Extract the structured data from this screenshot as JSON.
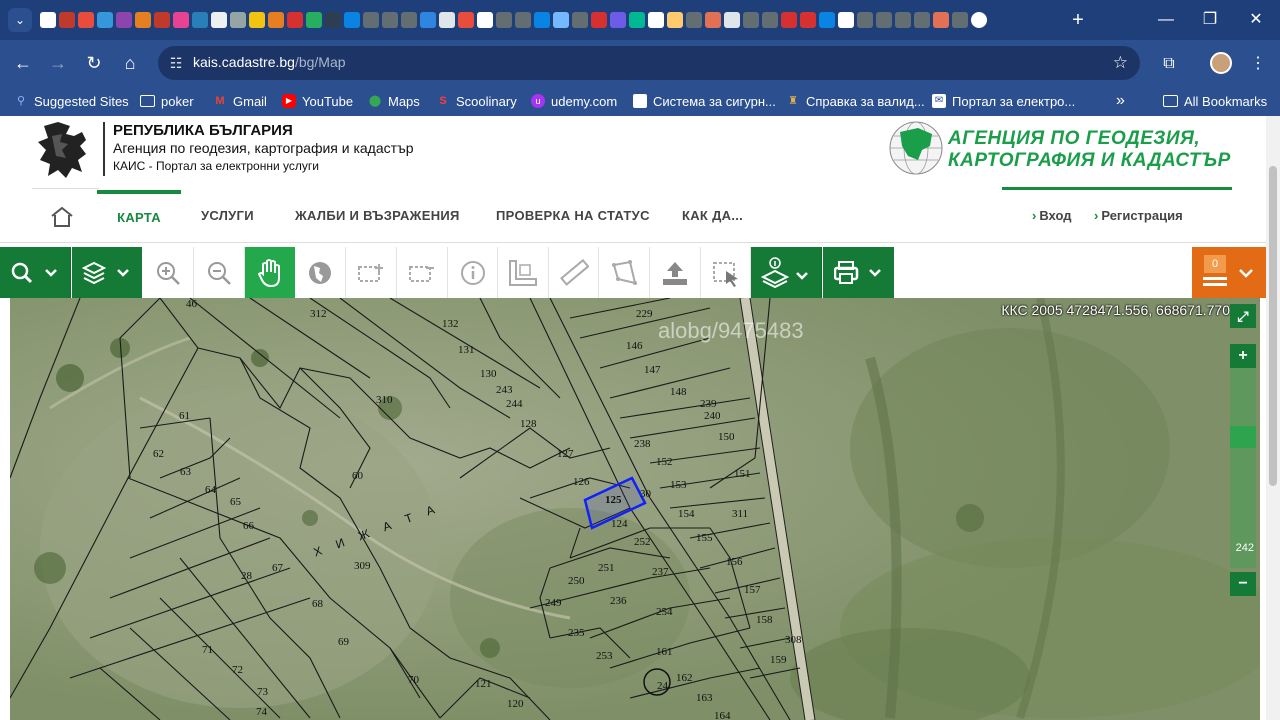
{
  "browser": {
    "address": {
      "host": "kais.cadastre.bg",
      "path": "/bg/Map"
    },
    "bookmarks": [
      {
        "label": "Suggested Sites",
        "icon": "magnifier-icon"
      },
      {
        "label": "poker",
        "icon": "folder-icon"
      },
      {
        "label": "Gmail",
        "icon": "gmail-icon"
      },
      {
        "label": "YouTube",
        "icon": "youtube-icon"
      },
      {
        "label": "Maps",
        "icon": "maps-pin-icon"
      },
      {
        "label": "Scoolinary",
        "icon": "scoolinary-icon"
      },
      {
        "label": "udemy.com",
        "icon": "udemy-icon"
      },
      {
        "label": "Система за сигурн...",
        "icon": "page-icon"
      },
      {
        "label": "Справка за валид...",
        "icon": "crest-icon"
      },
      {
        "label": "Портал за електро...",
        "icon": "envelope-icon"
      }
    ],
    "all_bookmarks": "All Bookmarks",
    "more_bookmarks": "»"
  },
  "site": {
    "republic": "РЕПУБЛИКА БЪЛГАРИЯ",
    "agency_line": "Агенция по геодезия, картография и кадастър",
    "portal_line": "КАИС - Портал за електронни услуги",
    "agency_logo_line1": "АГЕНЦИЯ ПО ГЕОДЕЗИЯ,",
    "agency_logo_line2": "КАРТОГРАФИЯ И КАДАСТЪР",
    "nav": {
      "items": [
        "КАРТА",
        "УСЛУГИ",
        "ЖАЛБИ И ВЪЗРАЖЕНИЯ",
        "ПРОВЕРКА НА СТАТУС",
        "КАК ДА..."
      ],
      "active": "КАРТА",
      "login": "Вход",
      "register": "Регистрация"
    }
  },
  "map": {
    "coords": "ККС 2005 4728471.556, 668671.770",
    "watermark": "alobg/9475483",
    "print_count": "0",
    "zoom_level": "242",
    "area_label": "Х И Ж А Т А",
    "selected_parcel": "125",
    "parcels": [
      "132",
      "131",
      "130",
      "243",
      "244",
      "310",
      "128",
      "127",
      "126",
      "125",
      "124",
      "229",
      "146",
      "147",
      "148",
      "239",
      "240",
      "150",
      "238",
      "152",
      "153",
      "151",
      "154",
      "311",
      "155",
      "156",
      "157",
      "158",
      "159",
      "308",
      "252",
      "237",
      "251",
      "250",
      "236",
      "249",
      "254",
      "235",
      "253",
      "161",
      "162",
      "163",
      "164",
      "61",
      "62",
      "63",
      "64",
      "65",
      "66",
      "67",
      "68",
      "69",
      "70",
      "71",
      "72",
      "73",
      "74",
      "309",
      "60",
      "46",
      "312",
      "121",
      "120",
      "28",
      "24",
      "30"
    ]
  }
}
